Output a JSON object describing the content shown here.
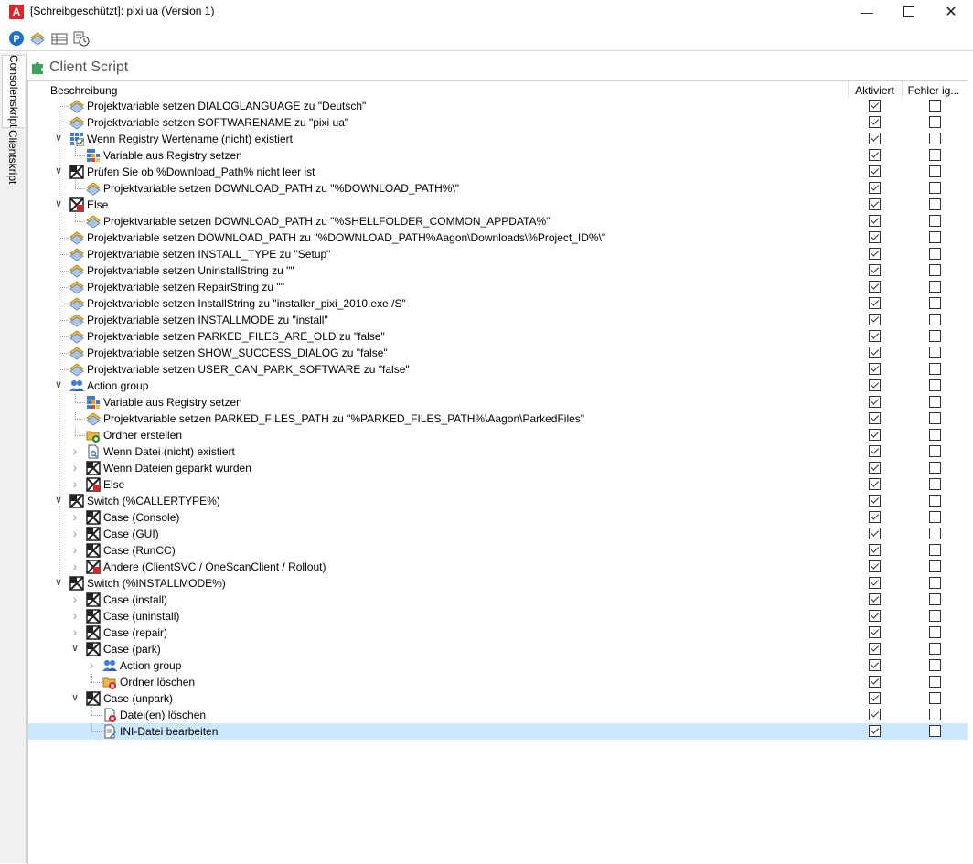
{
  "window": {
    "title": "[Schreibgeschützt]: pixi ua (Version 1)",
    "minimize_icon": "minimize-icon",
    "maximize_icon": "maximize-icon",
    "close_icon": "close-icon"
  },
  "toolbar": {
    "icons": [
      "p-circle-icon",
      "variable-icon",
      "table-icon",
      "schedule-icon"
    ]
  },
  "side_tabs": [
    "Consolenskript",
    "Clientskript"
  ],
  "panel": {
    "title": "Client Script",
    "icon": "puzzle-icon"
  },
  "columns": {
    "description": "Beschreibung",
    "activated": "Aktiviert",
    "ignore_errors": "Fehler ig..."
  },
  "rows": [
    {
      "label": "Projektvariable setzen DIALOGLANGUAGE zu \"Deutsch\"",
      "level": 0,
      "icon": "variable",
      "toggle": "",
      "active": true,
      "ignore": false
    },
    {
      "label": "Projektvariable setzen SOFTWARENAME zu \"pixi ua\"",
      "level": 0,
      "icon": "variable",
      "toggle": "",
      "active": true,
      "ignore": false
    },
    {
      "label": "Wenn Registry Wertename (nicht) existiert",
      "level": 0,
      "icon": "registry-check",
      "toggle": "open",
      "active": true,
      "ignore": false
    },
    {
      "label": "Variable aus Registry setzen",
      "level": 1,
      "icon": "registry",
      "toggle": "",
      "active": true,
      "ignore": false
    },
    {
      "label": "Prüfen Sie ob %Download_Path% nicht leer ist",
      "level": 0,
      "icon": "branch",
      "toggle": "open",
      "active": true,
      "ignore": false
    },
    {
      "label": "Projektvariable setzen DOWNLOAD_PATH zu \"%DOWNLOAD_PATH%\\\"",
      "level": 1,
      "icon": "variable",
      "toggle": "",
      "active": true,
      "ignore": false
    },
    {
      "label": "Else",
      "level": 0,
      "icon": "branch-else",
      "toggle": "open",
      "active": true,
      "ignore": false
    },
    {
      "label": "Projektvariable setzen DOWNLOAD_PATH zu \"%SHELLFOLDER_COMMON_APPDATA%\"",
      "level": 1,
      "icon": "variable",
      "toggle": "",
      "active": true,
      "ignore": false
    },
    {
      "label": "Projektvariable setzen DOWNLOAD_PATH zu \"%DOWNLOAD_PATH%Aagon\\Downloads\\%Project_ID%\\\"",
      "level": 0,
      "icon": "variable",
      "toggle": "",
      "active": true,
      "ignore": false
    },
    {
      "label": "Projektvariable setzen INSTALL_TYPE zu \"Setup\"",
      "level": 0,
      "icon": "variable",
      "toggle": "",
      "active": true,
      "ignore": false
    },
    {
      "label": "Projektvariable setzen UninstallString zu \"\"",
      "level": 0,
      "icon": "variable",
      "toggle": "",
      "active": true,
      "ignore": false
    },
    {
      "label": "Projektvariable setzen RepairString zu \"\"",
      "level": 0,
      "icon": "variable",
      "toggle": "",
      "active": true,
      "ignore": false
    },
    {
      "label": "Projektvariable setzen InstallString zu \"installer_pixi_2010.exe /S\"",
      "level": 0,
      "icon": "variable",
      "toggle": "",
      "active": true,
      "ignore": false
    },
    {
      "label": "Projektvariable setzen INSTALLMODE zu \"install\"",
      "level": 0,
      "icon": "variable",
      "toggle": "",
      "active": true,
      "ignore": false
    },
    {
      "label": "Projektvariable setzen PARKED_FILES_ARE_OLD zu \"false\"",
      "level": 0,
      "icon": "variable",
      "toggle": "",
      "active": true,
      "ignore": false
    },
    {
      "label": "Projektvariable setzen SHOW_SUCCESS_DIALOG zu \"false\"",
      "level": 0,
      "icon": "variable",
      "toggle": "",
      "active": true,
      "ignore": false
    },
    {
      "label": "Projektvariable setzen USER_CAN_PARK_SOFTWARE zu \"false\"",
      "level": 0,
      "icon": "variable",
      "toggle": "",
      "active": true,
      "ignore": false
    },
    {
      "label": "Action group",
      "level": 0,
      "icon": "group",
      "toggle": "open",
      "active": true,
      "ignore": false
    },
    {
      "label": "Variable aus Registry setzen",
      "level": 1,
      "icon": "registry",
      "toggle": "",
      "active": true,
      "ignore": false
    },
    {
      "label": "Projektvariable setzen PARKED_FILES_PATH zu \"%PARKED_FILES_PATH%\\Aagon\\ParkedFiles\"",
      "level": 1,
      "icon": "variable",
      "toggle": "",
      "active": true,
      "ignore": false
    },
    {
      "label": "Ordner erstellen",
      "level": 1,
      "icon": "folder-add",
      "toggle": "",
      "active": true,
      "ignore": false
    },
    {
      "label": "Wenn Datei (nicht) existiert",
      "level": 1,
      "icon": "file-search",
      "toggle": "closed",
      "active": true,
      "ignore": false
    },
    {
      "label": "Wenn Dateien geparkt wurden",
      "level": 1,
      "icon": "branch",
      "toggle": "closed",
      "active": true,
      "ignore": false
    },
    {
      "label": "Else",
      "level": 1,
      "icon": "branch-else",
      "toggle": "closed",
      "active": true,
      "ignore": false
    },
    {
      "label": "Switch (%CALLERTYPE%)",
      "level": 0,
      "icon": "branch",
      "toggle": "open",
      "active": true,
      "ignore": false
    },
    {
      "label": "Case (Console)",
      "level": 1,
      "icon": "branch",
      "toggle": "closed",
      "active": true,
      "ignore": false
    },
    {
      "label": "Case (GUI)",
      "level": 1,
      "icon": "branch",
      "toggle": "closed",
      "active": true,
      "ignore": false
    },
    {
      "label": "Case (RunCC)",
      "level": 1,
      "icon": "branch",
      "toggle": "closed",
      "active": true,
      "ignore": false
    },
    {
      "label": "Andere (ClientSVC / OneScanClient / Rollout)",
      "level": 1,
      "icon": "branch-else",
      "toggle": "closed",
      "active": true,
      "ignore": false
    },
    {
      "label": "Switch (%INSTALLMODE%)",
      "level": 0,
      "icon": "branch",
      "toggle": "open",
      "active": true,
      "ignore": false
    },
    {
      "label": "Case (install)",
      "level": 1,
      "icon": "branch",
      "toggle": "closed",
      "active": true,
      "ignore": false
    },
    {
      "label": "Case (uninstall)",
      "level": 1,
      "icon": "branch",
      "toggle": "closed",
      "active": true,
      "ignore": false
    },
    {
      "label": "Case (repair)",
      "level": 1,
      "icon": "branch",
      "toggle": "closed",
      "active": true,
      "ignore": false
    },
    {
      "label": "Case (park)",
      "level": 1,
      "icon": "branch",
      "toggle": "open",
      "active": true,
      "ignore": false
    },
    {
      "label": "Action group",
      "level": 2,
      "icon": "group",
      "toggle": "closed",
      "active": true,
      "ignore": false
    },
    {
      "label": "Ordner löschen",
      "level": 2,
      "icon": "folder-delete",
      "toggle": "",
      "active": true,
      "ignore": false
    },
    {
      "label": "Case (unpark)",
      "level": 1,
      "icon": "branch",
      "toggle": "open",
      "active": true,
      "ignore": false
    },
    {
      "label": "Datei(en) löschen",
      "level": 2,
      "icon": "file-delete",
      "toggle": "",
      "active": true,
      "ignore": false
    },
    {
      "label": "INI-Datei bearbeiten",
      "level": 2,
      "icon": "file-edit",
      "toggle": "",
      "active": true,
      "ignore": false,
      "selected": true
    }
  ],
  "colors": {
    "selection": "#cce8ff",
    "accent": "#1a6fc8",
    "app_icon": "#d8262a"
  }
}
